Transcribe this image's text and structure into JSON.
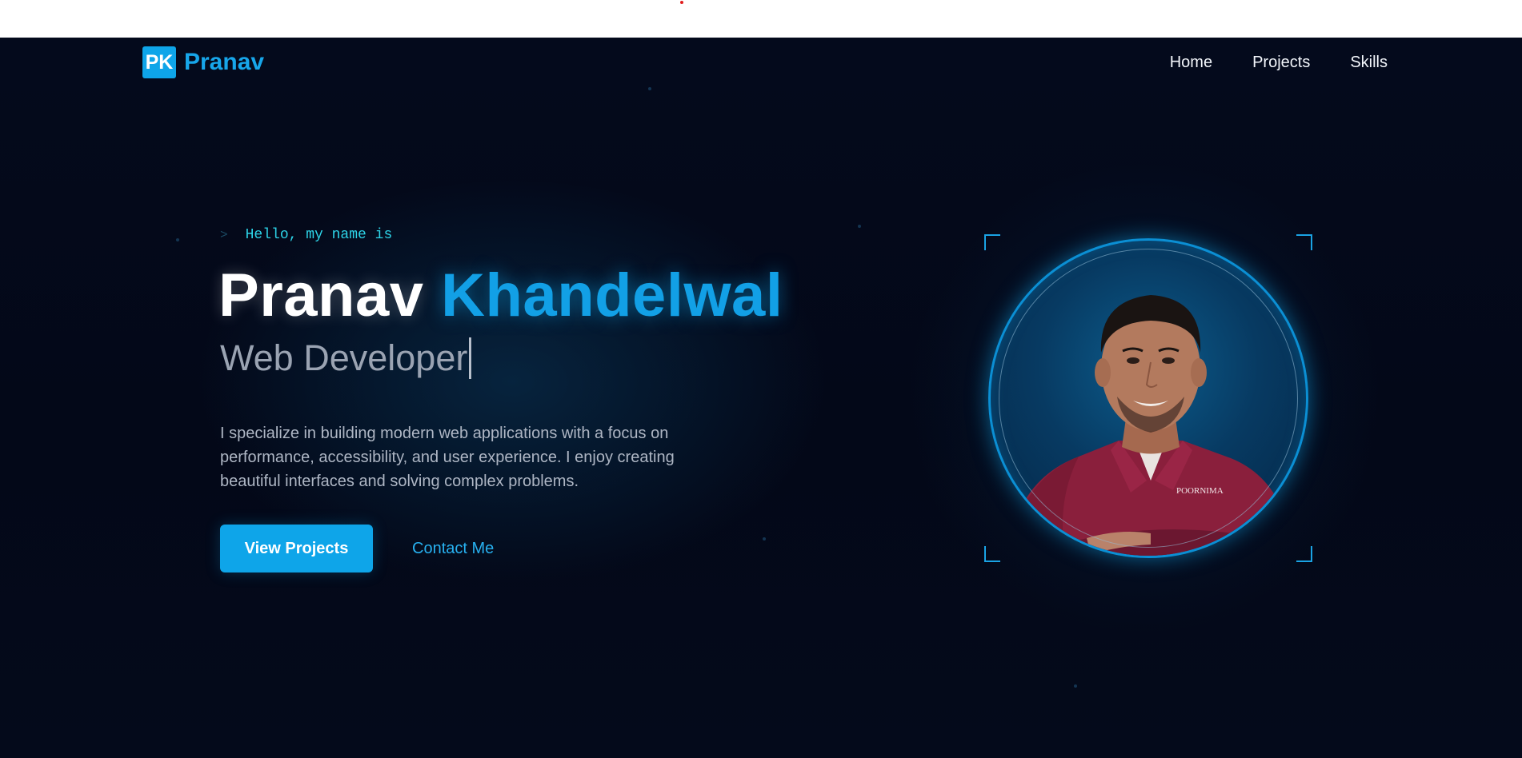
{
  "header": {
    "logo_badge": "PK",
    "logo_name": "Pranav",
    "nav": [
      {
        "label": "Home"
      },
      {
        "label": "Projects"
      },
      {
        "label": "Skills"
      }
    ]
  },
  "hero": {
    "caret": ">",
    "greeting": "Hello, my name is",
    "first_name": "Pranav",
    "last_name": "Khandelwal",
    "role": "Web Developer",
    "bio": "I specialize in building modern web applications with a focus on performance, accessibility, and user experience. I enjoy creating beautiful interfaces and solving complex problems.",
    "primary_button": "View Projects",
    "secondary_button": "Contact Me"
  },
  "profile": {
    "shirt_text": "POORNIMA"
  },
  "colors": {
    "accent": "#0ea5e9",
    "background": "#030818",
    "text_muted": "#9aa3b2"
  }
}
